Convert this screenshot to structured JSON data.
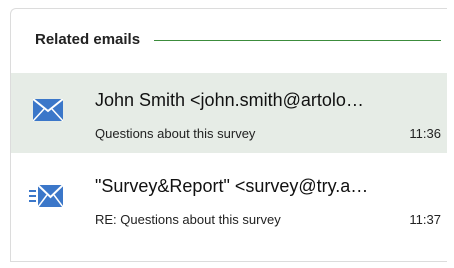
{
  "related": {
    "title": "Related emails",
    "emails": [
      {
        "sender": "John Smith <john.smith@artolo…",
        "subject": "Questions about this survey",
        "time": "11:36",
        "icon": "envelope-icon",
        "selected": true
      },
      {
        "sender": "\"Survey&Report\" <survey@try.a…",
        "subject": "RE: Questions about this survey",
        "time": "11:37",
        "icon": "reply-envelope-icon",
        "selected": false
      }
    ]
  },
  "colors": {
    "accent_line": "#3c8c3c",
    "icon_blue": "#3b77c9",
    "selected_bg": "#e6ece6"
  }
}
